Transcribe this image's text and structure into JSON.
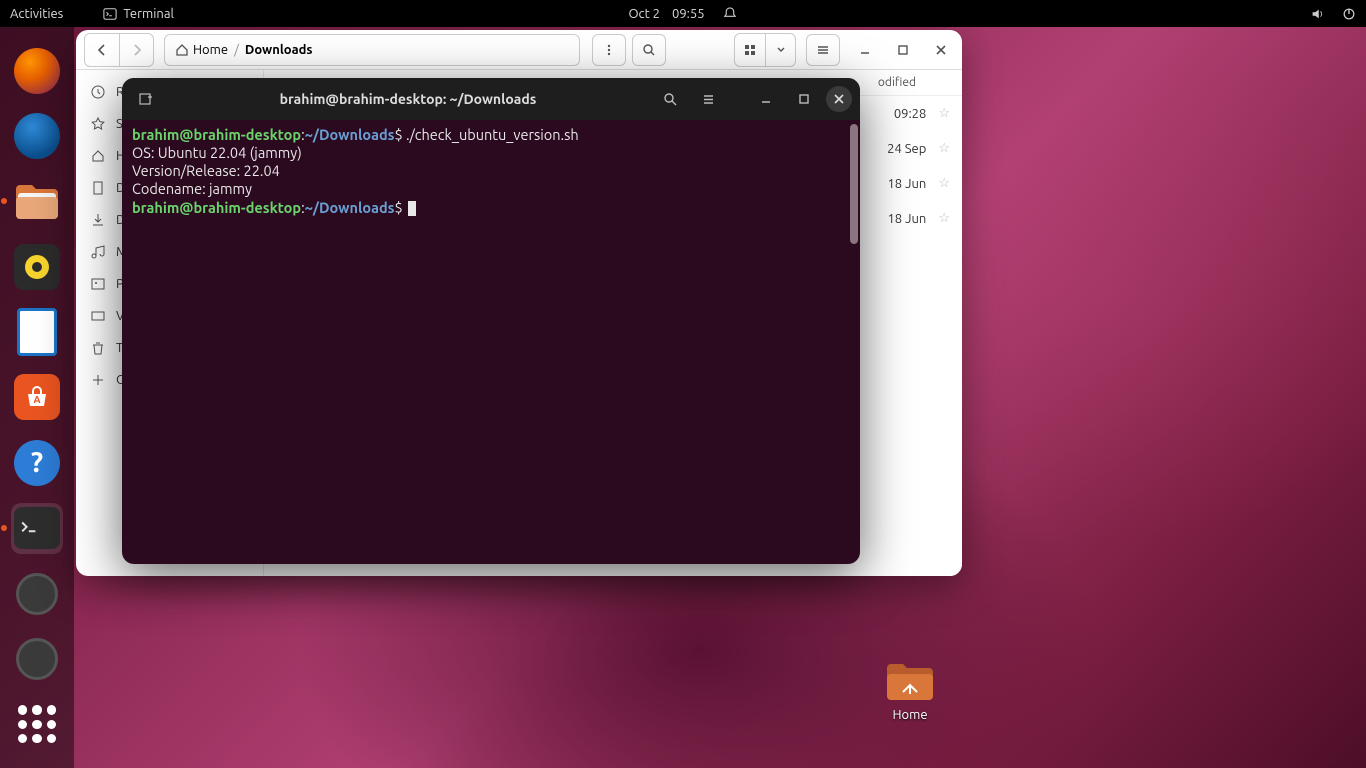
{
  "topbar": {
    "activities": "Activities",
    "app_name": "Terminal",
    "date": "Oct 2",
    "time": "09:55"
  },
  "dock": {
    "items": [
      "firefox",
      "thunderbird",
      "files",
      "rhythmbox",
      "writer",
      "software",
      "help",
      "terminal",
      "disk1",
      "disk2"
    ]
  },
  "desktop": {
    "home_label": "Home"
  },
  "files": {
    "crumb_home": "Home",
    "crumb_current": "Downloads",
    "col_modified": "odified",
    "sidebar": [
      "Re",
      "S",
      "H",
      "D",
      "D",
      "M",
      "P",
      "V",
      "T",
      "O"
    ],
    "rows": [
      {
        "date": "09:28"
      },
      {
        "date": "24 Sep"
      },
      {
        "date": "18 Jun"
      },
      {
        "date": "18 Jun"
      }
    ]
  },
  "terminal": {
    "title": "brahim@brahim-desktop: ~/Downloads",
    "prompt_user": "brahim@brahim-desktop",
    "prompt_path": "~/Downloads",
    "cmd1": "./check_ubuntu_version.sh",
    "out1": "OS: Ubuntu 22.04 (jammy)",
    "out2": "Version/Release: 22.04",
    "out3": "Codename: jammy"
  }
}
